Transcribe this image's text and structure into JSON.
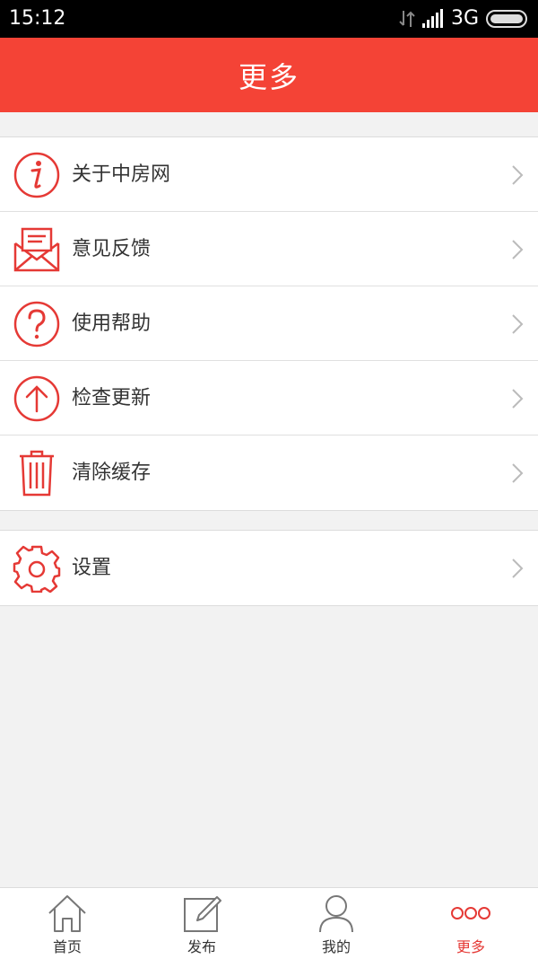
{
  "status_bar": {
    "time": "15:12",
    "network": "3G"
  },
  "header": {
    "title": "更多"
  },
  "menu_group_1": [
    {
      "label": "关于中房网",
      "icon": "info-icon"
    },
    {
      "label": "意见反馈",
      "icon": "mail-icon"
    },
    {
      "label": "使用帮助",
      "icon": "help-icon"
    },
    {
      "label": "检查更新",
      "icon": "arrow-up-icon"
    },
    {
      "label": "清除缓存",
      "icon": "trash-icon"
    }
  ],
  "menu_group_2": [
    {
      "label": "设置",
      "icon": "gear-icon"
    }
  ],
  "tabbar": [
    {
      "label": "首页",
      "icon": "home-icon",
      "active": false
    },
    {
      "label": "发布",
      "icon": "edit-icon",
      "active": false
    },
    {
      "label": "我的",
      "icon": "user-icon",
      "active": false
    },
    {
      "label": "更多",
      "icon": "more-icon",
      "active": true
    }
  ],
  "colors": {
    "accent": "#f44336",
    "icon_red": "#e53935",
    "background": "#f2f2f2"
  }
}
